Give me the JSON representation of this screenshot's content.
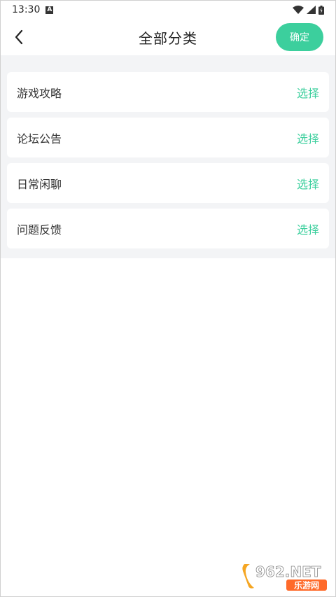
{
  "status_bar": {
    "time": "13:30",
    "notification_icon": "A"
  },
  "header": {
    "title": "全部分类",
    "confirm_label": "确定"
  },
  "categories": [
    {
      "name": "游戏攻略",
      "action": "选择"
    },
    {
      "name": "论坛公告",
      "action": "选择"
    },
    {
      "name": "日常闲聊",
      "action": "选择"
    },
    {
      "name": "问题反馈",
      "action": "选择"
    }
  ],
  "watermark": {
    "top": "962.NET",
    "bottom": "乐游网"
  },
  "colors": {
    "accent": "#3ccf9d",
    "background_panel": "#f3f4f6"
  }
}
